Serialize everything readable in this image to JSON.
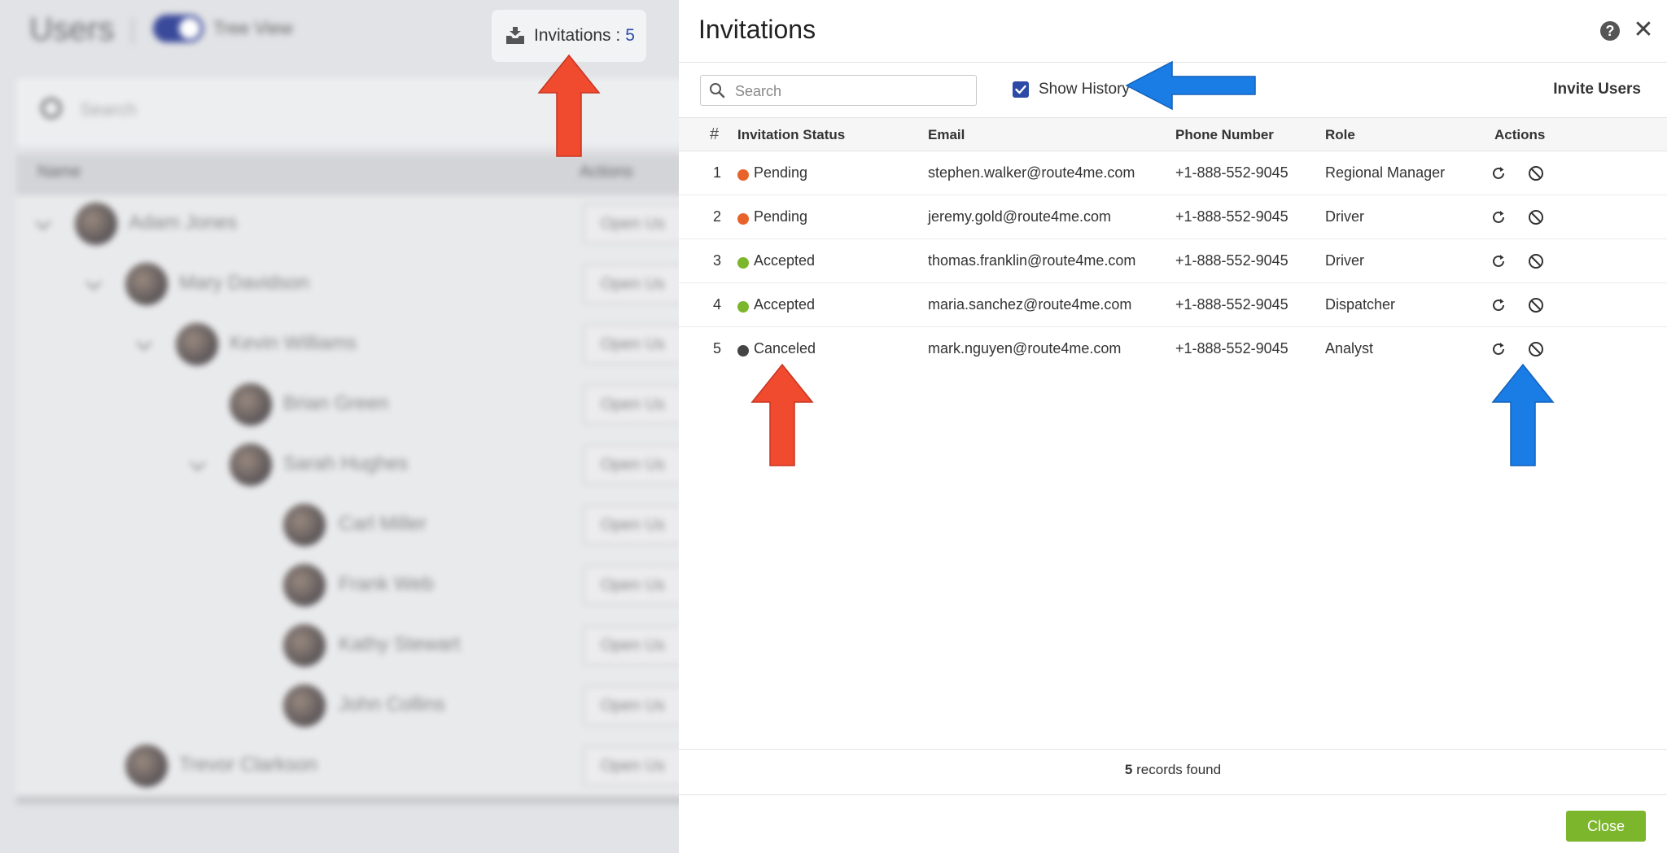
{
  "background": {
    "title": "Users",
    "tree_view_label": "Tree View",
    "search_placeholder": "Search",
    "col_name": "Name",
    "col_actions": "Actions",
    "open_button_label": "Open Us",
    "users": [
      {
        "name": "Adam Jones"
      },
      {
        "name": "Mary Davidson"
      },
      {
        "name": "Kevin Williams"
      },
      {
        "name": "Brian Green"
      },
      {
        "name": "Sarah Hughes"
      },
      {
        "name": "Carl Miller"
      },
      {
        "name": "Frank Web"
      },
      {
        "name": "Kathy Stewart"
      },
      {
        "name": "John Collins"
      },
      {
        "name": "Trevor Clarkson"
      }
    ]
  },
  "invitations_chip": {
    "label": "Invitations :",
    "count": "5"
  },
  "modal": {
    "title": "Invitations",
    "search_placeholder": "Search",
    "show_history_label": "Show History",
    "show_history_checked": true,
    "invite_users_label": "Invite Users",
    "columns": {
      "hash": "#",
      "status": "Invitation Status",
      "email": "Email",
      "phone": "Phone Number",
      "role": "Role",
      "actions": "Actions"
    },
    "rows": [
      {
        "num": "1",
        "status": "Pending",
        "status_color": "#e8632a",
        "email": "stephen.walker@route4me.com",
        "phone": "+1-888-552-9045",
        "role": "Regional Manager"
      },
      {
        "num": "2",
        "status": "Pending",
        "status_color": "#e8632a",
        "email": "jeremy.gold@route4me.com",
        "phone": "+1-888-552-9045",
        "role": "Driver"
      },
      {
        "num": "3",
        "status": "Accepted",
        "status_color": "#7cb62c",
        "email": "thomas.franklin@route4me.com",
        "phone": "+1-888-552-9045",
        "role": "Driver"
      },
      {
        "num": "4",
        "status": "Accepted",
        "status_color": "#7cb62c",
        "email": "maria.sanchez@route4me.com",
        "phone": "+1-888-552-9045",
        "role": "Dispatcher"
      },
      {
        "num": "5",
        "status": "Canceled",
        "status_color": "#444444",
        "email": "mark.nguyen@route4me.com",
        "phone": "+1-888-552-9045",
        "role": "Analyst"
      }
    ],
    "records_count": "5",
    "records_suffix": "records found",
    "close_label": "Close"
  },
  "colors": {
    "accent_blue": "#2d4aa7",
    "close_green": "#7cb62c",
    "arrow_red": "#f04a2f",
    "arrow_blue": "#1a7de6"
  }
}
